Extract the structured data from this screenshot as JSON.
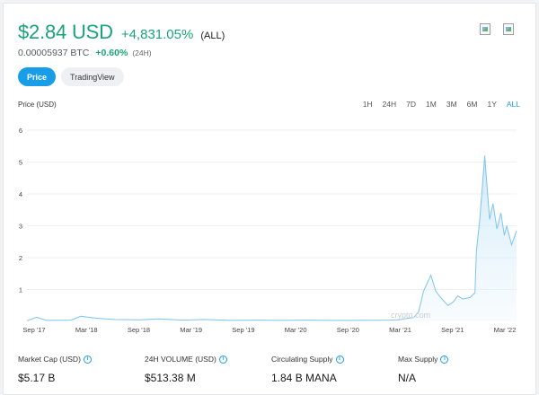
{
  "header": {
    "price": "$2.84 USD",
    "change": "+4,831.05%",
    "period": "(ALL)",
    "btc_price": "0.00005937 BTC",
    "btc_change": "+0.60%",
    "btc_period": "(24H)"
  },
  "icons": [
    "broken-image-icon",
    "broken-image-icon",
    "info-icon"
  ],
  "view_tabs": [
    {
      "label": "Price",
      "active": true
    },
    {
      "label": "TradingView",
      "active": false
    }
  ],
  "chart_label": "Price (USD)",
  "time_ranges": [
    "1H",
    "24H",
    "7D",
    "1M",
    "3M",
    "6M",
    "1Y",
    "ALL"
  ],
  "active_range": "ALL",
  "watermark": "crypto.com",
  "colors": {
    "accent": "#1a9de8",
    "positive": "#1aa37a",
    "line": "#7fc4ee"
  },
  "chart_data": {
    "type": "area",
    "title": "",
    "xlabel": "",
    "ylabel": "Price (USD)",
    "ylim": [
      0,
      6
    ],
    "yticks": [
      1,
      2,
      3,
      4,
      5,
      6
    ],
    "xticks": [
      "Sep '17",
      "Mar '18",
      "Sep '18",
      "Mar '19",
      "Sep '19",
      "Mar '20",
      "Sep '20",
      "Mar '21",
      "Sep '21",
      "Mar '22"
    ],
    "grid": true,
    "series": [
      {
        "values": [
          0.02,
          0.13,
          0.03,
          0.04,
          0.16,
          0.1,
          0.06,
          0.05,
          0.08,
          0.04,
          0.06,
          0.03,
          0.04,
          0.03,
          0.04,
          0.03,
          0.03,
          0.035,
          0.04,
          0.05,
          0.08,
          0.1,
          0.12,
          0.3,
          0.95,
          1.45,
          0.95,
          0.75,
          0.5,
          0.6,
          0.8,
          0.7,
          0.75,
          0.9,
          2.2,
          3.2,
          5.2,
          4.2,
          3.2,
          3.7,
          2.9,
          3.4,
          2.7,
          3.0,
          2.4,
          2.84
        ]
      }
    ],
    "x_positions": [
      0,
      0.02,
      0.04,
      0.09,
      0.11,
      0.14,
      0.18,
      0.23,
      0.27,
      0.32,
      0.36,
      0.42,
      0.47,
      0.52,
      0.57,
      0.62,
      0.66,
      0.7,
      0.74,
      0.76,
      0.77,
      0.78,
      0.79,
      0.8,
      0.81,
      0.825,
      0.835,
      0.845,
      0.86,
      0.87,
      0.88,
      0.89,
      0.905,
      0.915,
      0.918,
      0.925,
      0.935,
      0.94,
      0.945,
      0.952,
      0.96,
      0.968,
      0.975,
      0.98,
      0.99,
      1.0
    ]
  },
  "stats": [
    {
      "label": "Market Cap (USD)",
      "value": "$5.17 B"
    },
    {
      "label": "24H VOLUME (USD)",
      "value": "$513.38 M"
    },
    {
      "label": "Circulating Supply",
      "value": "1.84 B MANA"
    },
    {
      "label": "Max Supply",
      "value": "N/A"
    }
  ]
}
